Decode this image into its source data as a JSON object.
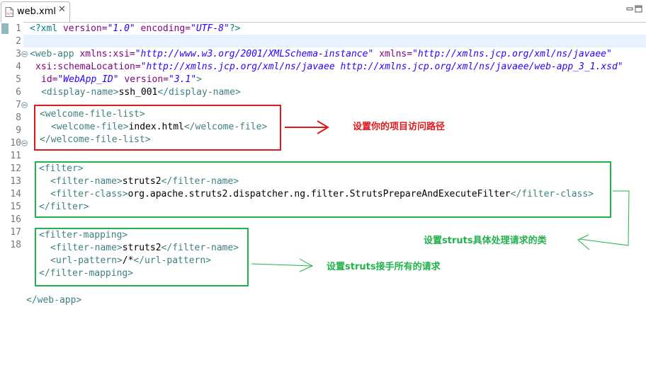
{
  "tab": {
    "title": "web.xml",
    "close": "✕"
  },
  "line_numbers": [
    "1",
    "2",
    "3",
    "4",
    "5",
    "6",
    "7",
    "8",
    "9",
    "10",
    "11",
    "12",
    "13",
    "14",
    "15",
    "16",
    "17",
    "18"
  ],
  "code": {
    "l1": {
      "a": "<?xml ",
      "b": "version=",
      "c": "\"1.0\"",
      "d": " encoding=",
      "e": "\"UTF-8\"",
      "f": "?>"
    },
    "l3": {
      "a": "<web-app ",
      "b": "xmlns:xsi=",
      "c": "\"http://www.w3.org/2001/XMLSchema-instance\"",
      "d": " xmlns=",
      "e": "\"http://xmlns.jcp.org/xml/ns/javaee\""
    },
    "l4": {
      "a": "xsi:schemaLocation=",
      "b": "\"http://xmlns.jcp.org/xml/ns/javaee http://xmlns.jcp.org/xml/ns/javaee/web-app_3_1.xsd\""
    },
    "l5": {
      "a": "id=",
      "b": "\"WebApp_ID\"",
      "c": " version=",
      "d": "\"3.1\"",
      "e": ">"
    },
    "l6": {
      "a": "<display-name>",
      "b": "ssh_001",
      "c": "</display-name>"
    },
    "l8": {
      "a": "<welcome-file-list>"
    },
    "l9": {
      "a": "<welcome-file>",
      "b": "index.html",
      "c": "</welcome-file>"
    },
    "l10": {
      "a": "</welcome-file-list>"
    },
    "l12": {
      "a": "<filter>"
    },
    "l13": {
      "a": "<filter-name>",
      "b": "struts2",
      "c": "</filter-name>"
    },
    "l14": {
      "a": "<filter-class>",
      "b": "org.apache.struts2.dispatcher.ng.filter.StrutsPrepareAndExecuteFilter",
      "c": "</filter-class>"
    },
    "l15": {
      "a": "</filter>"
    },
    "l17": {
      "a": "<filter-mapping>"
    },
    "l18": {
      "a": "<filter-name>",
      "b": "struts2",
      "c": "</filter-name>"
    },
    "l19": {
      "a": "<url-pattern>",
      "b": "/*",
      "c": "</url-pattern>"
    },
    "l20": {
      "a": "</filter-mapping>"
    },
    "l22": {
      "a": "</web-app>"
    }
  },
  "annotations": {
    "welcome": "设置你的项目访问路径",
    "filter_class": "设置struts具体处理请求的类",
    "filter_mapping": "设置struts接手所有的请求"
  },
  "colors": {
    "tag": "#3f7f7f",
    "attribute": "#7f007f",
    "string": "#2a00ff",
    "red_annotation": "#e0191c",
    "green_annotation": "#22b14c"
  }
}
